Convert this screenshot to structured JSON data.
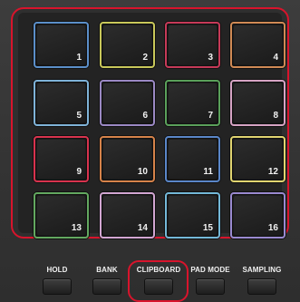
{
  "pads": [
    {
      "number": "1",
      "color": "#5b8fc9"
    },
    {
      "number": "2",
      "color": "#c9c85a"
    },
    {
      "number": "3",
      "color": "#c63a58"
    },
    {
      "number": "4",
      "color": "#d08a55"
    },
    {
      "number": "5",
      "color": "#7fb3d8"
    },
    {
      "number": "6",
      "color": "#9b89c4"
    },
    {
      "number": "7",
      "color": "#5aa05a"
    },
    {
      "number": "8",
      "color": "#d6a4c4"
    },
    {
      "number": "9",
      "color": "#d8334e"
    },
    {
      "number": "10",
      "color": "#d6834a"
    },
    {
      "number": "11",
      "color": "#5a86c8"
    },
    {
      "number": "12",
      "color": "#e0d470"
    },
    {
      "number": "13",
      "color": "#63a860"
    },
    {
      "number": "14",
      "color": "#d2a6d2"
    },
    {
      "number": "15",
      "color": "#74b8d8"
    },
    {
      "number": "16",
      "color": "#9a8ad0"
    }
  ],
  "buttons": [
    {
      "label": "HOLD"
    },
    {
      "label": "BANK"
    },
    {
      "label": "CLIPBOARD"
    },
    {
      "label": "PAD MODE"
    },
    {
      "label": "SAMPLING"
    }
  ],
  "highlight_color": "#d8142c"
}
